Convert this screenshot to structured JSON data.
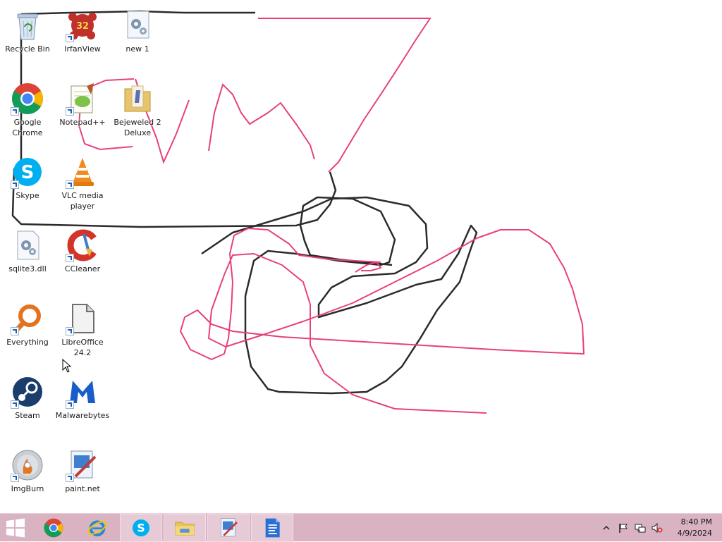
{
  "desktop": {
    "icons": [
      {
        "label": "Recycle Bin",
        "icon": "recycle-bin-icon",
        "shortcut": false
      },
      {
        "label": "IrfanView",
        "icon": "irfanview-icon",
        "shortcut": true,
        "badge": "32"
      },
      {
        "label": "new 1",
        "icon": "settings-file-icon",
        "shortcut": false
      },
      {
        "label": "Google Chrome",
        "icon": "chrome-icon",
        "shortcut": true
      },
      {
        "label": "Notepad++",
        "icon": "notepadpp-icon",
        "shortcut": true
      },
      {
        "label": "Bejeweled 2 Deluxe",
        "icon": "folder-icon",
        "shortcut": false
      },
      {
        "label": "Skype",
        "icon": "skype-icon",
        "shortcut": true
      },
      {
        "label": "VLC media player",
        "icon": "vlc-icon",
        "shortcut": true
      },
      {
        "label": "sqlite3.dll",
        "icon": "dll-file-icon",
        "shortcut": false
      },
      {
        "label": "CCleaner",
        "icon": "ccleaner-icon",
        "shortcut": true
      },
      {
        "label": "Everything",
        "icon": "everything-search-icon",
        "shortcut": true
      },
      {
        "label": "LibreOffice 24.2",
        "icon": "libreoffice-icon",
        "shortcut": true
      },
      {
        "label": "Steam",
        "icon": "steam-icon",
        "shortcut": true
      },
      {
        "label": "Malwarebytes",
        "icon": "malwarebytes-icon",
        "shortcut": true
      },
      {
        "label": "ImgBurn",
        "icon": "imgburn-icon",
        "shortcut": true
      },
      {
        "label": "paint.net",
        "icon": "paintnet-icon",
        "shortcut": true
      }
    ]
  },
  "colors": {
    "taskbar": "#d9b3c2",
    "scribble_pink": "#e8417a",
    "scribble_black": "#2b2b2b"
  },
  "taskbar": {
    "start_icon": "windows-start-icon",
    "pinned": [
      {
        "icon": "chrome-icon",
        "open": false
      },
      {
        "icon": "internet-explorer-icon",
        "open": false
      },
      {
        "icon": "skype-icon",
        "open": true
      },
      {
        "icon": "file-explorer-icon",
        "open": true
      },
      {
        "icon": "paintnet-icon",
        "open": true
      },
      {
        "icon": "libreoffice-writer-icon",
        "open": true
      }
    ],
    "tray": {
      "icons": [
        "show-hidden-icons-chevron-icon",
        "action-center-flag-icon",
        "network-icon",
        "volume-muted-icon"
      ],
      "time": "8:40 PM",
      "date": "4/9/2024"
    }
  }
}
